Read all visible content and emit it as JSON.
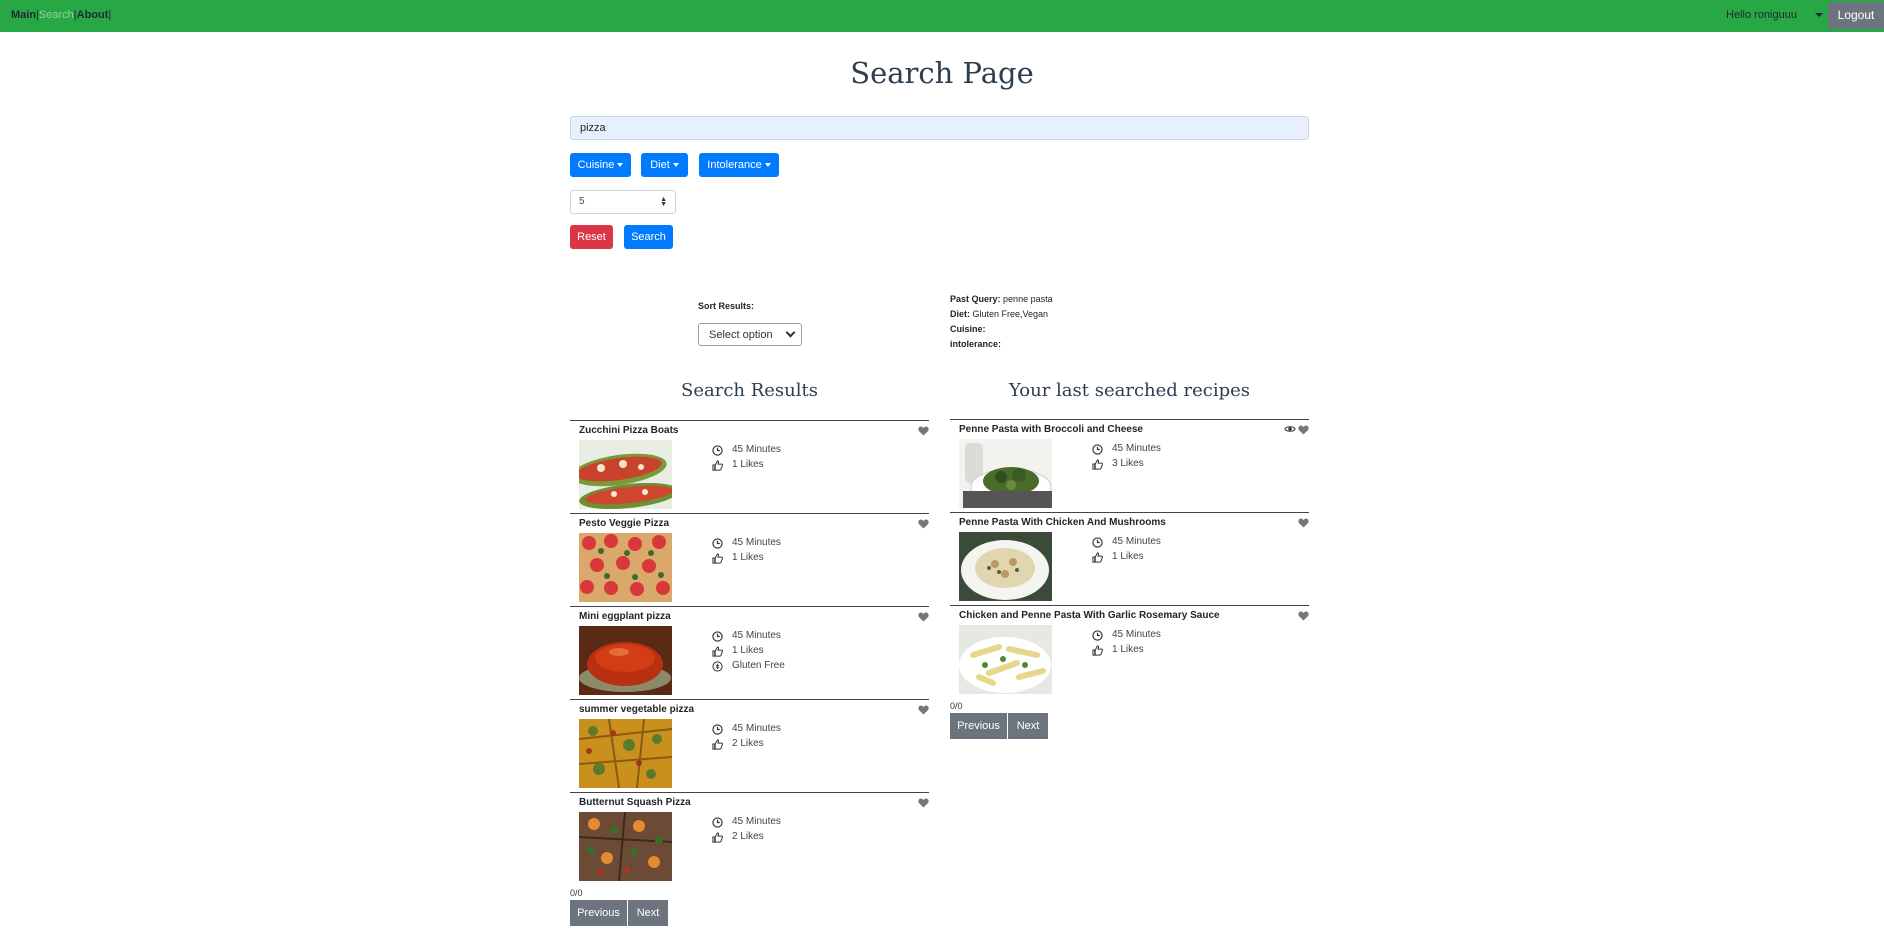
{
  "navbar": {
    "links": [
      "Main",
      "Search",
      "About"
    ],
    "separator": "|",
    "greeting": "Hello roniguuu",
    "logout_label": "Logout",
    "color": "#28a745"
  },
  "page": {
    "title": "Search Page"
  },
  "search": {
    "query": "pizza"
  },
  "filters": {
    "cuisine_label": "Cuisine",
    "diet_label": "Diet",
    "intolerance_label": "Intolerance"
  },
  "results_count": {
    "selected": "5"
  },
  "actions": {
    "reset_label": "Reset",
    "search_label": "Search"
  },
  "sort": {
    "label": "Sort Results:",
    "placeholder": "Select option"
  },
  "past_query": {
    "query_label": "Past Query:",
    "query_value": "penne pasta",
    "diet_label": "Diet:",
    "diet_value": "Gluten Free,Vegan",
    "cuisine_label": "Cuisine:",
    "cuisine_value": "",
    "intolerance_label": "intolerance:",
    "intolerance_value": ""
  },
  "search_results": {
    "heading": "Search Results",
    "items": [
      {
        "title": "Zucchini Pizza Boats",
        "time": "45 Minutes",
        "likes": "1 Likes",
        "image": "zucchini-pizza-image"
      },
      {
        "title": "Pesto Veggie Pizza",
        "time": "45 Minutes",
        "likes": "1 Likes",
        "image": "pesto-pizza-image"
      },
      {
        "title": "Mini eggplant pizza",
        "time": "45 Minutes",
        "likes": "1 Likes",
        "diet": "Gluten Free",
        "image": "eggplant-pizza-image"
      },
      {
        "title": "summer vegetable pizza",
        "time": "45 Minutes",
        "likes": "2 Likes",
        "image": "vegetable-pizza-image"
      },
      {
        "title": "Butternut Squash Pizza",
        "time": "45 Minutes",
        "likes": "2 Likes",
        "image": "squash-pizza-image"
      }
    ],
    "counter": "0/0",
    "prev_label": "Previous",
    "next_label": "Next"
  },
  "last_searched": {
    "heading": "Your last searched recipes",
    "items": [
      {
        "title": "Penne Pasta with Broccoli and Cheese",
        "time": "45 Minutes",
        "likes": "3 Likes",
        "viewed": true,
        "image": "broccoli-pasta-image"
      },
      {
        "title": "Penne Pasta With Chicken And Mushrooms",
        "time": "45 Minutes",
        "likes": "1 Likes",
        "image": "chicken-mushroom-pasta-image"
      },
      {
        "title": "Chicken and Penne Pasta With Garlic Rosemary Sauce",
        "time": "45 Minutes",
        "likes": "1 Likes",
        "image": "garlic-rosemary-pasta-image"
      }
    ],
    "counter": "0/0",
    "prev_label": "Previous",
    "next_label": "Next"
  },
  "colors": {
    "primary": "#007bff",
    "danger": "#dc3545",
    "secondary": "#6c757d",
    "heading": "#2c3e50"
  },
  "icons": {
    "time": "clock-icon",
    "likes": "thumbs-up-icon",
    "diet": "gluten-free-icon",
    "favorite": "heart-icon",
    "viewed": "eye-icon"
  }
}
